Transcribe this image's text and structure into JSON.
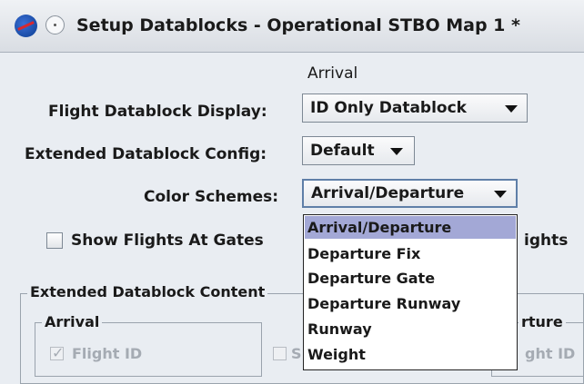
{
  "window": {
    "title": "Setup Datablocks - Operational STBO Map 1 *"
  },
  "column_header": "Arrival",
  "rows": {
    "flight_datablock_display": {
      "label": "Flight Datablock Display:",
      "value": "ID Only Datablock"
    },
    "extended_datablock_config": {
      "label": "Extended Datablock Config:",
      "value": "Default"
    },
    "color_schemes": {
      "label": "Color Schemes:",
      "value": "Arrival/Departure"
    }
  },
  "show_flights_at_gates": {
    "label": "Show Flights At Gates",
    "checked": false,
    "trailing_text": "ights"
  },
  "extended_content": {
    "title": "Extended Datablock Content",
    "arrival_group": {
      "title": "Arrival",
      "flight_id": "Flight ID"
    },
    "departure_group": {
      "title_partial": "rture",
      "flight_id_partial": "ght ID"
    },
    "middle_partial": "S"
  },
  "dropdown_options": [
    "Arrival/Departure",
    "Departure Fix",
    "Departure Gate",
    "Departure Runway",
    "Runway",
    "Weight"
  ],
  "colors": {
    "selection": "#a3a8d6",
    "background": "#e9edf2"
  }
}
